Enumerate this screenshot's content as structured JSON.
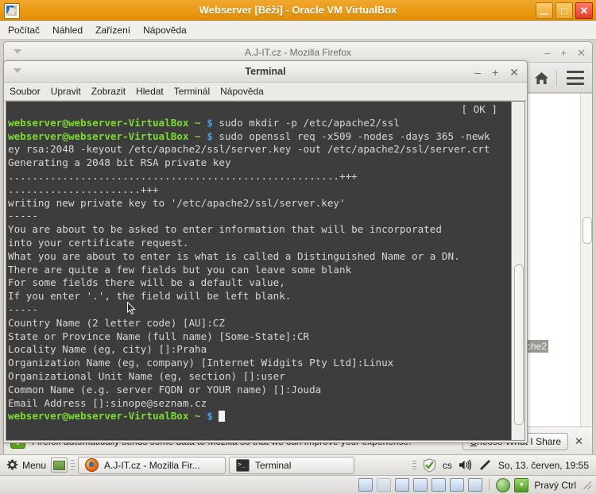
{
  "vbox": {
    "title": "Webserver [Běží] - Oracle VM VirtualBox",
    "menu": [
      "Počítač",
      "Náhled",
      "Zařízení",
      "Nápověda"
    ],
    "buttons": {
      "minimize": "—",
      "maximize": "□",
      "close": "✕"
    },
    "statusbar": {
      "host_key": "Pravý Ctrl"
    }
  },
  "firefox": {
    "title": "A.J-IT.cz - Mozilla Firefox",
    "buttons": {
      "minimize": "–",
      "maximize": "+",
      "close": "✕"
    },
    "page_fragment": "che2",
    "notification": {
      "text": "Firefox automatically sends some data to Mozilla so that we can improve your experience.",
      "button_underlined": "C",
      "button_rest": "hoose What I Share",
      "close": "✕"
    }
  },
  "terminal": {
    "title": "Terminal",
    "menu": [
      "Soubor",
      "Upravit",
      "Zobrazit",
      "Hledat",
      "Terminál",
      "Nápověda"
    ],
    "buttons": {
      "minimize": "–",
      "maximize": "+",
      "close": "✕"
    },
    "status_ok": "[ OK ]",
    "prompt": "webserver@webserver-VirtualBox",
    "prompt_dir": "~",
    "prompt_sigil": "$",
    "commands": [
      "sudo mkdir -p /etc/apache2/ssl",
      "sudo openssl req -x509 -nodes -days 365 -newkey rsa:2048 -keyout /etc/apache2/ssl/server.key -out /etc/apache2/ssl/server.crt"
    ],
    "output": [
      "Generating a 2048 bit RSA private key",
      ".......................................................+++",
      "......................+++",
      "writing new private key to '/etc/apache2/ssl/server.key'",
      "-----",
      "You are about to be asked to enter information that will be incorporated",
      "into your certificate request.",
      "What you are about to enter is what is called a Distinguished Name or a DN.",
      "There are quite a few fields but you can leave some blank",
      "For some fields there will be a default value,",
      "If you enter '.', the field will be left blank.",
      "-----",
      "Country Name (2 letter code) [AU]:CZ",
      "State or Province Name (full name) [Some-State]:CR",
      "Locality Name (eg, city) []:Praha",
      "Organization Name (eg, company) [Internet Widgits Pty Ltd]:Linux",
      "Organizational Unit Name (eg, section) []:user",
      "Common Name (e.g. server FQDN or YOUR name) []:Jouda",
      "Email Address []:sinope@seznam.cz"
    ],
    "colors": {
      "background": "#3d3d3d",
      "foreground": "#d6d6d6",
      "prompt_green": "#7ddc2f",
      "dollar_blue": "#4aa3e8"
    }
  },
  "taskbar": {
    "menu_label": "Menu",
    "tasks": [
      {
        "label": "A.J-IT.cz - Mozilla Fir...",
        "icon": "firefox-icon"
      },
      {
        "label": "Terminal",
        "icon": "terminal-icon"
      }
    ],
    "tray": {
      "keyboard_layout": "cs",
      "clock": "So, 13. červen, 19:55"
    }
  }
}
